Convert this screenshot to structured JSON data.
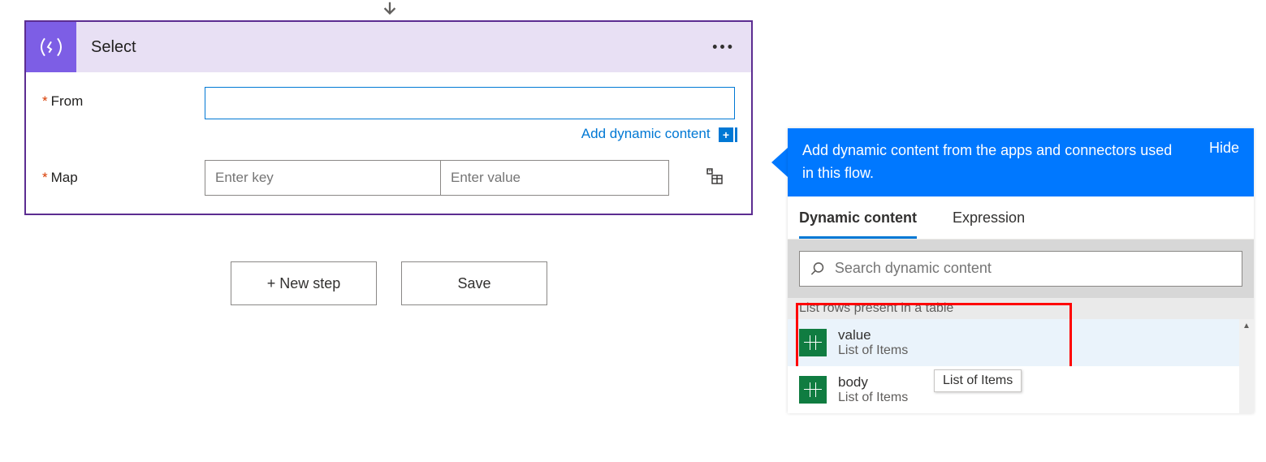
{
  "select_card": {
    "title": "Select",
    "from_label": "From",
    "map_label": "Map",
    "map_key_placeholder": "Enter key",
    "map_value_placeholder": "Enter value",
    "add_dynamic_text": "Add dynamic content"
  },
  "buttons": {
    "new_step": "+ New step",
    "save": "Save"
  },
  "dynamic_panel": {
    "header_text": "Add dynamic content from the apps and connectors used in this flow.",
    "hide_label": "Hide",
    "tabs": {
      "dynamic": "Dynamic content",
      "expression": "Expression"
    },
    "search_placeholder": "Search dynamic content",
    "group_title": "List rows present in a table",
    "items": [
      {
        "title": "value",
        "desc": "List of Items"
      },
      {
        "title": "body",
        "desc": "List of Items"
      }
    ],
    "tooltip": "List of Items"
  }
}
